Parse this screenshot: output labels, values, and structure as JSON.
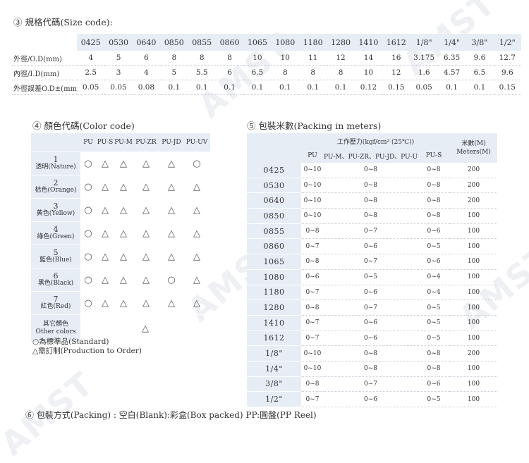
{
  "size_section": {
    "title": "③ 規格代碼(Size code):",
    "codes": [
      "0425",
      "0530",
      "0640",
      "0850",
      "0855",
      "0860",
      "1065",
      "1080",
      "1180",
      "1280",
      "1410",
      "1612",
      "1/8\"",
      "1/4\"",
      "3/8\"",
      "1/2\""
    ],
    "rows": [
      {
        "label": "外徑/O.D(mm)",
        "values": [
          "4",
          "5",
          "6",
          "8",
          "8",
          "8",
          "10",
          "10",
          "11",
          "12",
          "14",
          "16",
          "3.175",
          "6.35",
          "9.6",
          "12.7"
        ]
      },
      {
        "label": "內徑/I.D(mm)",
        "values": [
          "2.5",
          "3",
          "4",
          "5",
          "5.5",
          "6",
          "6.5",
          "8",
          "8",
          "8",
          "10",
          "12",
          "1.6",
          "4.57",
          "6.5",
          "9.6"
        ]
      },
      {
        "label": "外徑誤差O.D±(mm)",
        "values": [
          "0.05",
          "0.05",
          "0.08",
          "0.1",
          "0.1",
          "0.1",
          "0.1",
          "0.1",
          "0.1",
          "0.1",
          "0.12",
          "0.15",
          "0.05",
          "0.1",
          "0.1",
          "0.15"
        ]
      }
    ]
  },
  "color_section": {
    "title": "④ 顏色代碼(Color code)",
    "columns": [
      "PU",
      "PU-S",
      "PU-M",
      "PU-ZR",
      "PU-JD",
      "PU-UV"
    ],
    "rows": [
      {
        "num": "1",
        "label": "透明(Nature)",
        "marks": [
          "○",
          "△",
          "△",
          "△",
          "△",
          "○"
        ]
      },
      {
        "num": "2",
        "label": "桔色(Orange)",
        "marks": [
          "○",
          "△",
          "△",
          "△",
          "△",
          "△"
        ]
      },
      {
        "num": "3",
        "label": "黄色(Yellow)",
        "marks": [
          "○",
          "△",
          "△",
          "△",
          "△",
          "△"
        ]
      },
      {
        "num": "4",
        "label": "綠色(Green)",
        "marks": [
          "○",
          "△",
          "△",
          "△",
          "△",
          "△"
        ]
      },
      {
        "num": "5",
        "label": "藍色(Blue)",
        "marks": [
          "○",
          "△",
          "△",
          "△",
          "△",
          "△"
        ]
      },
      {
        "num": "6",
        "label": "黑色(Black)",
        "marks": [
          "○",
          "△",
          "△",
          "△",
          "○",
          "△"
        ]
      },
      {
        "num": "7",
        "label": "紅色(Red)",
        "marks": [
          "○",
          "△",
          "△",
          "△",
          "△",
          "△"
        ]
      }
    ],
    "other": {
      "label_zh": "其它顏色",
      "label_en": "Other colors",
      "mark": "△"
    },
    "legend_standard": "○為標準品(Standard)",
    "legend_order": "△需訂制(Production to Order)"
  },
  "packing_section": {
    "title": "⑤ 包裝米數(Packing in meters)",
    "pressure_header": "工作壓力(kgf/cm² (25℃))",
    "meters_header_zh": "米數(M)",
    "meters_header_en": "Meters(M)",
    "sub_columns": [
      "PU",
      "PU-M、PU-ZR、PU-JD、PU-UV",
      "PU-S"
    ],
    "rows": [
      {
        "code": "0425",
        "pu": "0~10",
        "group": "0~8",
        "pus": "0~8",
        "meters": "200"
      },
      {
        "code": "0530",
        "pu": "0~10",
        "group": "0~8",
        "pus": "0~8",
        "meters": "200"
      },
      {
        "code": "0640",
        "pu": "0~10",
        "group": "0~8",
        "pus": "0~8",
        "meters": "200"
      },
      {
        "code": "0850",
        "pu": "0~10",
        "group": "0~8",
        "pus": "0~8",
        "meters": "100"
      },
      {
        "code": "0855",
        "pu": "0~8",
        "group": "0~7",
        "pus": "0~6",
        "meters": "100"
      },
      {
        "code": "0860",
        "pu": "0~7",
        "group": "0~6",
        "pus": "0~5",
        "meters": "100"
      },
      {
        "code": "1065",
        "pu": "0~8",
        "group": "0~7",
        "pus": "0~6",
        "meters": "100"
      },
      {
        "code": "1080",
        "pu": "0~6",
        "group": "0~5",
        "pus": "0~4",
        "meters": "100"
      },
      {
        "code": "1180",
        "pu": "0~7",
        "group": "0~6",
        "pus": "0~4",
        "meters": "100"
      },
      {
        "code": "1280",
        "pu": "0~8",
        "group": "0~7",
        "pus": "0~5",
        "meters": "100"
      },
      {
        "code": "1410",
        "pu": "0~7",
        "group": "0~6",
        "pus": "0~5",
        "meters": "100"
      },
      {
        "code": "1612",
        "pu": "0~7",
        "group": "0~6",
        "pus": "0~5",
        "meters": "100"
      },
      {
        "code": "1/8\"",
        "pu": "0~10",
        "group": "0~8",
        "pus": "0~8",
        "meters": "200"
      },
      {
        "code": "1/4\"",
        "pu": "0~10",
        "group": "0~8",
        "pus": "0~8",
        "meters": "100"
      },
      {
        "code": "3/8\"",
        "pu": "0~8",
        "group": "0~7",
        "pus": "0~6",
        "meters": "100"
      },
      {
        "code": "1/2\"",
        "pu": "0~7",
        "group": "0~6",
        "pus": "0~5",
        "meters": "100"
      }
    ]
  },
  "packaging_line": "⑥ 包裝方式(Packing) : 空白(Blank):彩盒(Box packed) PP:圓盤(PP Reel)",
  "watermark_text": "AMST",
  "colors": {
    "header_fill": "#e6edf5",
    "row_divider": "#b9c3d2",
    "text": "#333333"
  }
}
